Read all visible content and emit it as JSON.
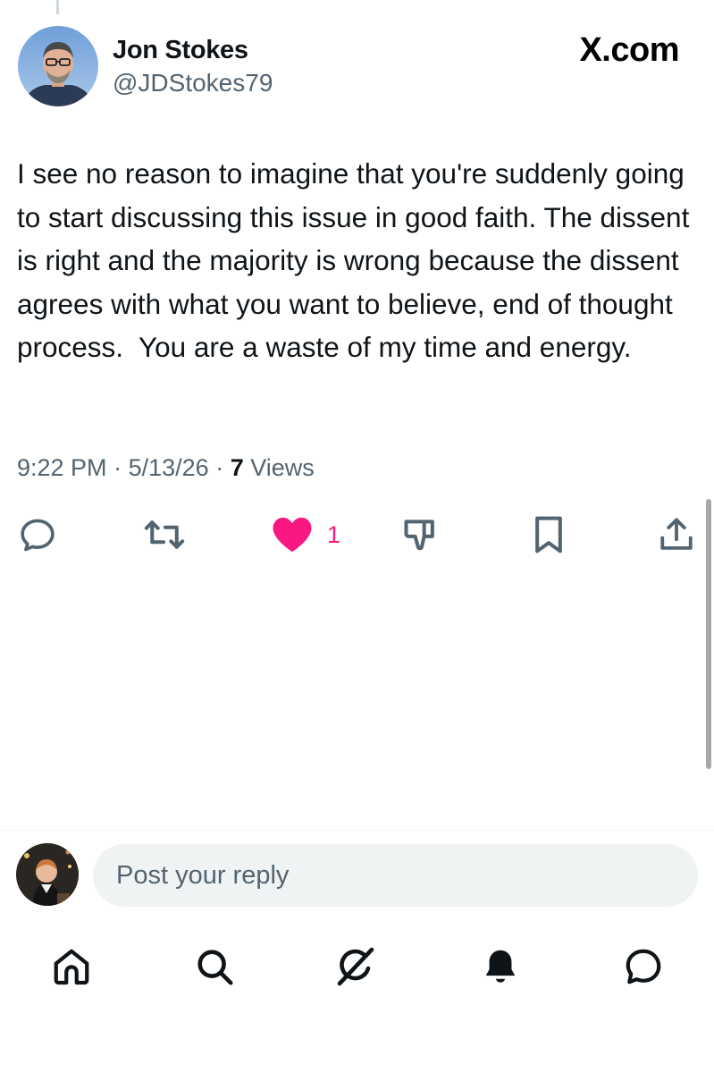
{
  "author": {
    "name": "Jon Stokes",
    "handle": "@JDStokes79",
    "avatar_icon": "person-photo-icon"
  },
  "brand": {
    "label": "X.com"
  },
  "tweet": {
    "text": "I see no reason to imagine that you're suddenly going to start discussing this issue in good faith. The dissent is right and the majority is wrong because the dissent agrees with what you want to believe, end of thought process.  You are a waste of my time and energy.",
    "time": "9:22 PM",
    "separator": "·",
    "date": "5/13/26",
    "views_count": "7",
    "views_label": "Views"
  },
  "actions": {
    "reply_icon": "reply-icon",
    "retweet_icon": "retweet-icon",
    "like_icon": "heart-filled-icon",
    "like_count": "1",
    "like_color": "#f91880",
    "dislike_icon": "thumbs-down-icon",
    "bookmark_icon": "bookmark-icon",
    "share_icon": "share-icon"
  },
  "reply_composer": {
    "placeholder": "Post your reply",
    "avatar_icon": "user-avatar-icon"
  },
  "bottom_nav": {
    "items": [
      "home-icon",
      "search-icon",
      "grok-icon",
      "notifications-icon",
      "messages-icon"
    ]
  },
  "colors": {
    "text_primary": "#0f1419",
    "text_secondary": "#536471",
    "reply_background": "#eff3f4"
  }
}
